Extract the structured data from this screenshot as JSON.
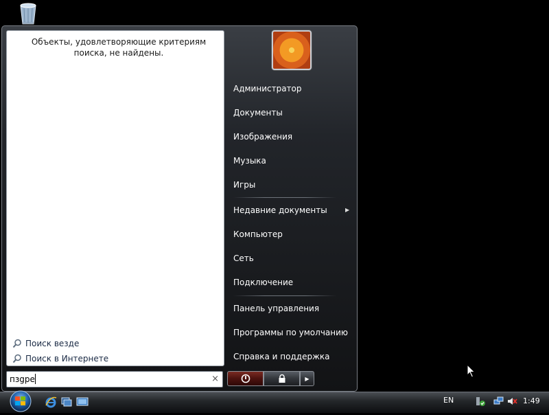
{
  "start_menu": {
    "search_results_message": "Объекты, удовлетворяющие критериям поиска, не найдены.",
    "search_links": [
      {
        "label": "Поиск везде",
        "icon": "search-icon"
      },
      {
        "label": "Поиск в Интернете",
        "icon": "search-icon"
      }
    ],
    "search_box": {
      "value": "пзgре",
      "clear_icon": "×"
    },
    "right_items": [
      {
        "label": "Администратор"
      },
      {
        "label": "Документы"
      },
      {
        "label": "Изображения"
      },
      {
        "label": "Музыка"
      },
      {
        "label": "Игры"
      },
      {
        "label": "Недавние документы",
        "has_submenu": true
      },
      {
        "label": "Компьютер"
      },
      {
        "label": "Сеть"
      },
      {
        "label": "Подключение"
      },
      {
        "label": "Панель управления"
      },
      {
        "label": "Программы по умолчанию"
      },
      {
        "label": "Справка и поддержка"
      }
    ],
    "power_buttons": [
      "power-icon",
      "lock-icon",
      "arrow-right-icon"
    ]
  },
  "taskbar": {
    "language": "EN",
    "clock": "1:49",
    "quick_launch": [
      "internet-explorer-icon",
      "switch-windows-icon",
      "show-desktop-icon"
    ],
    "tray_icons": [
      "safely-remove-hardware-icon",
      "network-icon",
      "volume-muted-icon"
    ]
  },
  "colors": {
    "menu_background": "#121315",
    "left_pane": "#ffffff",
    "power_button": "#6b2019",
    "taskbar": "#25282b"
  }
}
